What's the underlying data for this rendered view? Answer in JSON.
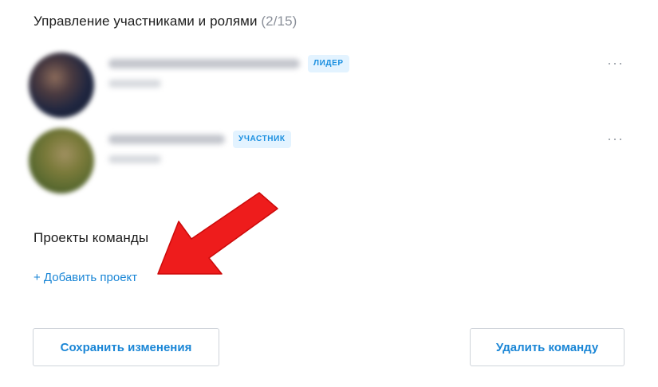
{
  "members_section": {
    "title": "Управление участниками и ролями",
    "count": "(2/15)"
  },
  "members": [
    {
      "role": "ЛИДЕР",
      "more": "···"
    },
    {
      "role": "УЧАСТНИК",
      "more": "···"
    }
  ],
  "projects_section": {
    "title": "Проекты команды",
    "add_label": "+ Добавить проект"
  },
  "buttons": {
    "save": "Сохранить изменения",
    "delete": "Удалить команду"
  },
  "colors": {
    "accent": "#1a86d6",
    "badge_bg": "#e3f3ff",
    "arrow": "#ee1c1c"
  }
}
